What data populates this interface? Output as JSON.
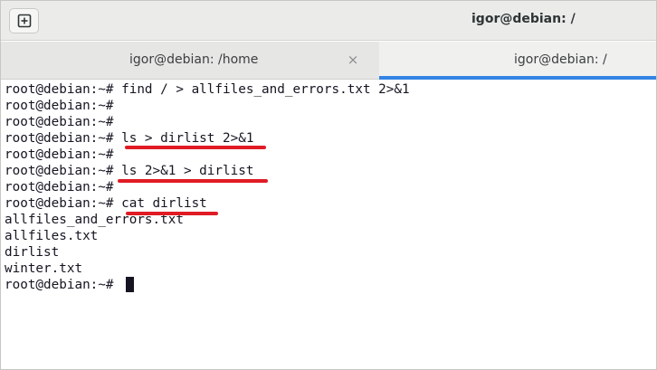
{
  "window": {
    "title": "igor@debian: /"
  },
  "tabs": [
    {
      "label": "igor@debian: /home",
      "close_glyph": "×",
      "active": false
    },
    {
      "label": "igor@debian: /",
      "active": true
    }
  ],
  "terminal": {
    "lines": [
      "root@debian:~# find / > allfiles_and_errors.txt 2>&1",
      "root@debian:~#",
      "root@debian:~#",
      "root@debian:~# ls > dirlist 2>&1",
      "root@debian:~#",
      "root@debian:~# ls 2>&1 > dirlist",
      "root@debian:~#",
      "root@debian:~# cat dirlist",
      "allfiles_and_errors.txt",
      "allfiles.txt",
      "dirlist",
      "winter.txt",
      "root@debian:~# "
    ],
    "annotation_color": "#e01b24"
  },
  "icons": {
    "new_tab": "new-tab-icon"
  }
}
